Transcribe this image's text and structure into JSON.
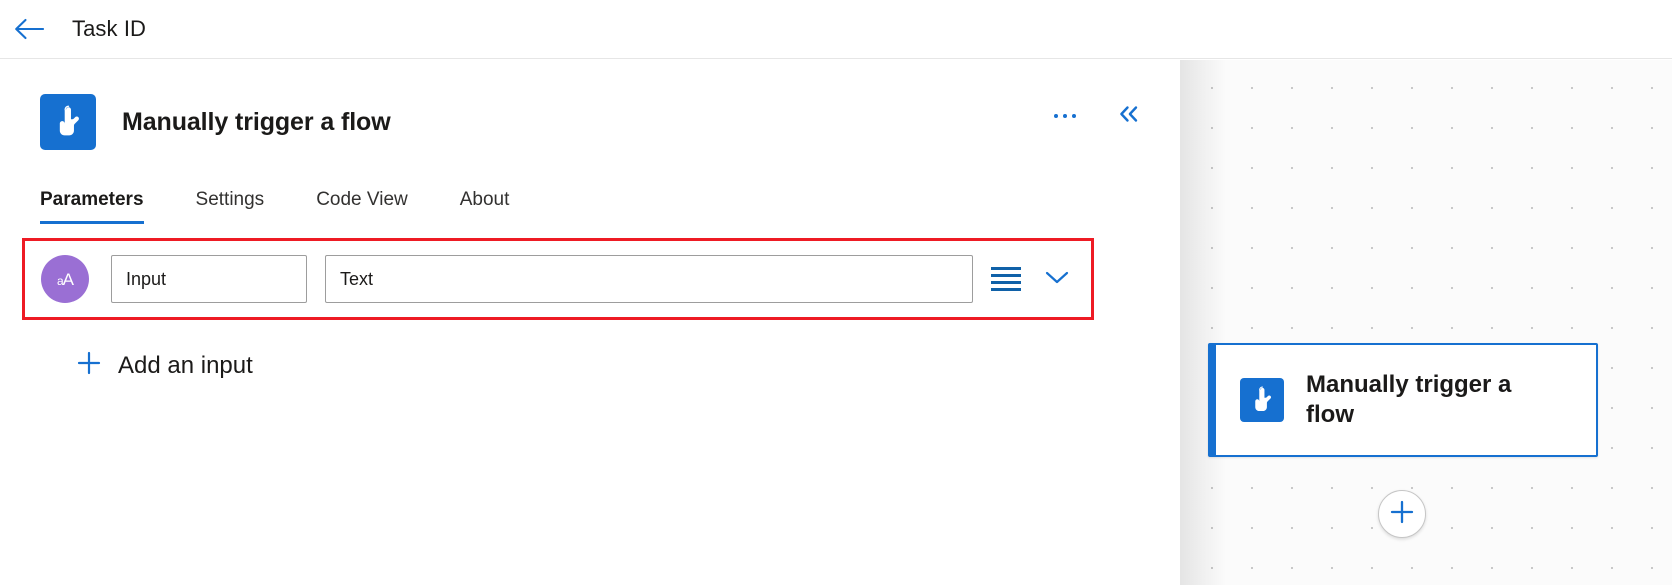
{
  "topbar": {
    "back_icon": "arrow-left-icon",
    "title": "Task ID"
  },
  "panel": {
    "icon": "manual-trigger-icon",
    "title": "Manually trigger a flow",
    "more_menu_label": "…",
    "collapse_label": "«",
    "tabs": [
      {
        "label": "Parameters",
        "active": true
      },
      {
        "label": "Settings",
        "active": false
      },
      {
        "label": "Code View",
        "active": false
      },
      {
        "label": "About",
        "active": false
      }
    ],
    "parameters": [
      {
        "type_icon": "text-type-icon",
        "type_icon_text_small": "a",
        "type_icon_text_large": "A",
        "name_value": "Input",
        "name_placeholder": "Input",
        "value_value": "Text",
        "value_placeholder": "Text",
        "list_icon": "list-icon",
        "chevron_icon": "chevron-down-icon"
      }
    ],
    "add_input": {
      "icon": "plus-icon",
      "label": "Add an input"
    },
    "highlight_color": "#ee1b24"
  },
  "canvas": {
    "node": {
      "icon": "manual-trigger-icon",
      "label": "Manually trigger a flow"
    },
    "add_step_button": {
      "icon": "plus-icon",
      "label": "+"
    }
  },
  "colors": {
    "accent": "#1670d0",
    "highlight": "#ee1b24",
    "type_purple": "#9a6fd4"
  }
}
